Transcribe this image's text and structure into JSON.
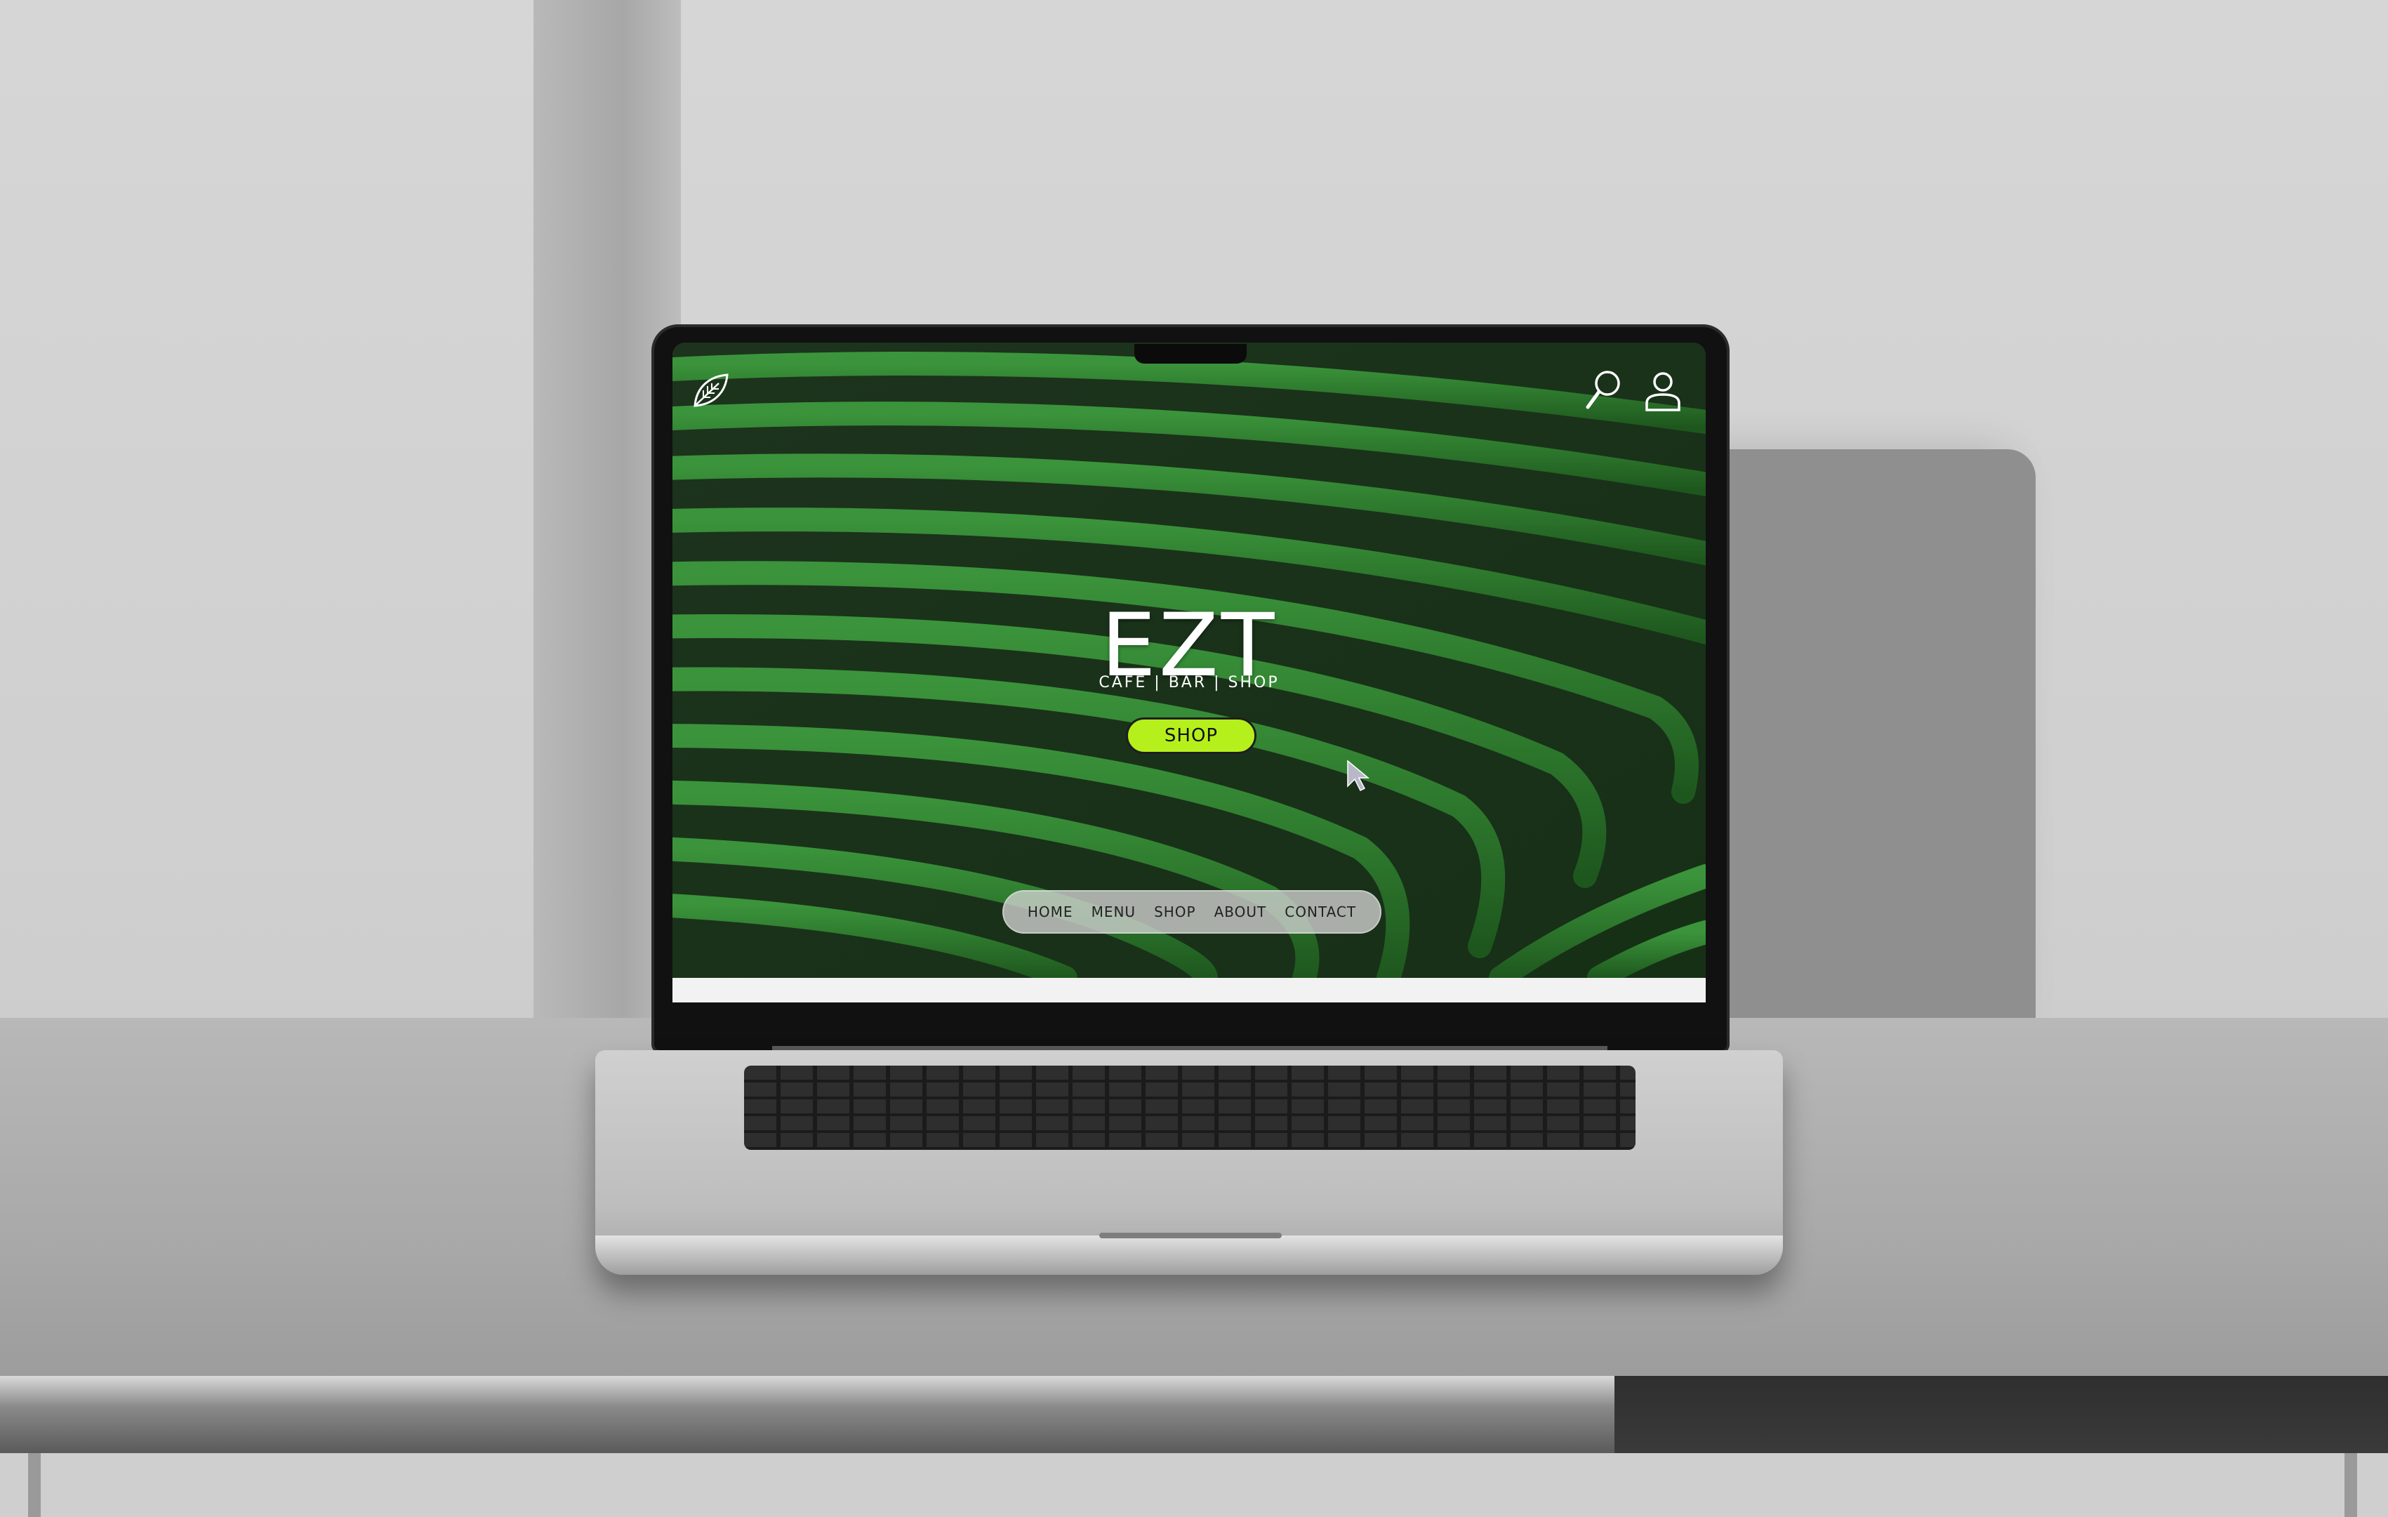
{
  "site": {
    "brand": "EZT",
    "tagline": "CAFE | BAR | SHOP",
    "cta_label": "SHOP",
    "nav": [
      {
        "label": "HOME"
      },
      {
        "label": "MENU"
      },
      {
        "label": "SHOP"
      },
      {
        "label": "ABOUT"
      },
      {
        "label": "CONTACT"
      }
    ],
    "icons": {
      "logo": "leaf-icon",
      "search": "search-icon",
      "account": "user-icon",
      "cursor": "cursor-arrow-icon"
    },
    "colors": {
      "accent": "#b6f01c",
      "hero_green": "#2f7a2f",
      "hero_dark": "#1a2a1a",
      "nav_pill": "#d2d2d2",
      "text_light": "#ffffff"
    }
  }
}
